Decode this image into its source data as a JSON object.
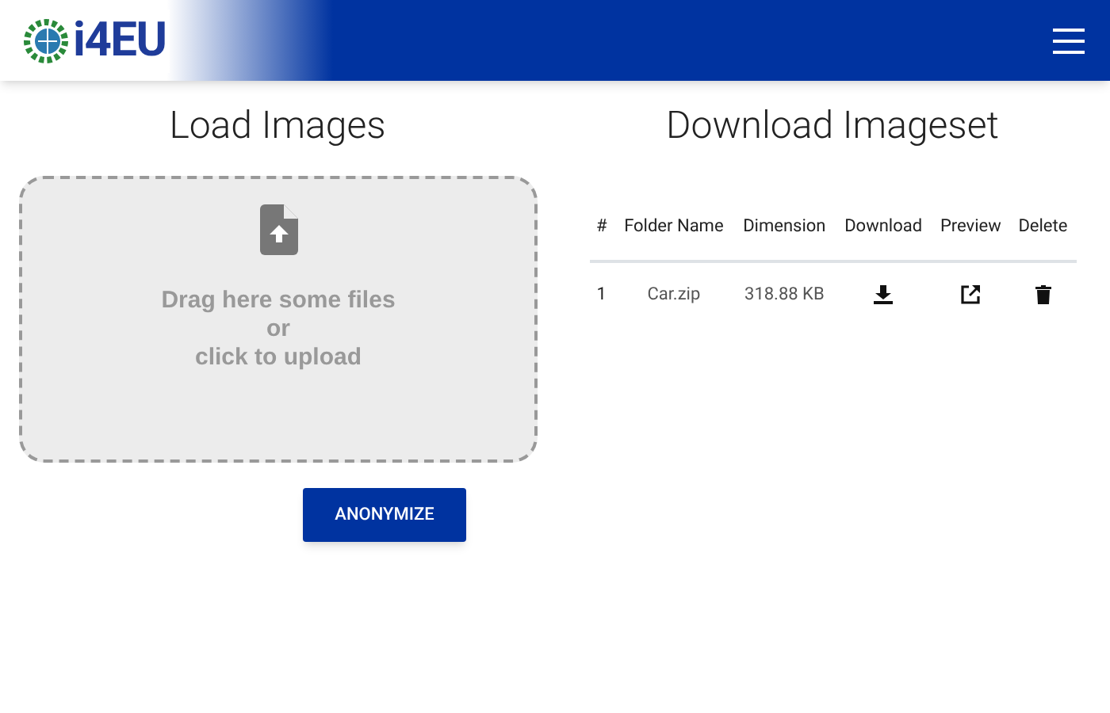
{
  "header": {
    "logo_text": "i4EU"
  },
  "load": {
    "title": "Load Images",
    "dropzone_lines": [
      "Drag here some files",
      "or",
      "click to upload"
    ],
    "button": "ANONYMIZE"
  },
  "download": {
    "title": "Download Imageset",
    "table": {
      "columns": [
        "#",
        "Folder Name",
        "Dimension",
        "Download",
        "Preview",
        "Delete"
      ],
      "rows": [
        {
          "index": "1",
          "folder_name": "Car.zip",
          "dimension": "318.88 KB"
        }
      ]
    }
  }
}
